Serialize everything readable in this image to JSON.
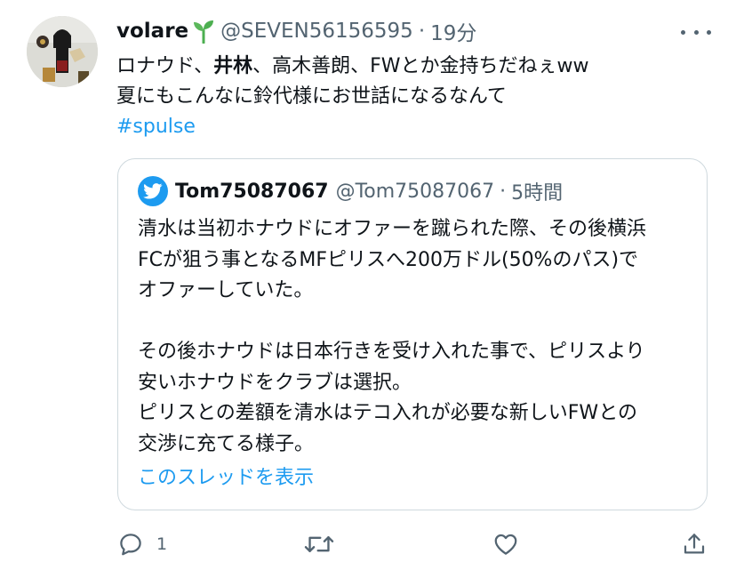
{
  "tweet": {
    "display_name": "volare",
    "handle": "@SEVEN56156595",
    "separator": "·",
    "time": "19分",
    "lines": [
      {
        "pre": "ロナウド、",
        "bold": "井林",
        "post": "、高木善朗、FWとか金持ちだねぇww"
      },
      {
        "pre": "夏にもこんなに鈴代様にお世話になるなんて"
      }
    ],
    "hashtag": "#spulse"
  },
  "quote": {
    "display_name": "Tom75087067",
    "handle": "@Tom75087067",
    "separator": "·",
    "time": "5時間",
    "lines": [
      "清水は当初ホナウドにオファーを蹴られた際、その後横浜",
      "FCが狙う事となるMFピリスへ200万ドル(50%のパス)で",
      "オファーしていた。",
      "",
      "その後ホナウドは日本行きを受け入れた事で、ピリスより",
      "安いホナウドをクラブは選択。",
      "ピリスとの差額を清水はテコ入れが必要な新しいFWとの",
      "交渉に充てる様子。"
    ],
    "show_thread": "このスレッドを表示"
  },
  "actions": {
    "reply_count": "1",
    "icons": [
      "reply-icon",
      "retweet-icon",
      "like-icon",
      "share-icon"
    ]
  },
  "colors": {
    "link": "#1d9bf0",
    "secondary_text": "#536471",
    "border": "#cfd9de",
    "sprout": "#4caf50"
  }
}
